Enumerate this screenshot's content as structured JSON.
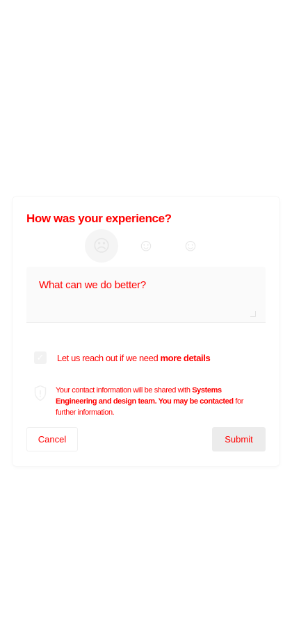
{
  "feedback": {
    "title": "How was your experience?",
    "ratings": [
      {
        "name": "sad-face-icon",
        "glyph": "☹",
        "selected": true
      },
      {
        "name": "neutral-face-icon",
        "glyph": "☺",
        "selected": false
      },
      {
        "name": "happy-face-icon",
        "glyph": "☺",
        "selected": false
      }
    ],
    "comment_placeholder": "What can we do better?",
    "reach_out": {
      "checked": true,
      "label_prefix": "Let us reach out if we need ",
      "label_bold": "more details"
    },
    "privacy": {
      "text_prefix": "Your contact information will be shared with ",
      "text_bold": "Systems Engineering and design team. You may be contacted",
      "text_suffix": " for further information."
    },
    "buttons": {
      "cancel": "Cancel",
      "submit": "Submit"
    }
  }
}
